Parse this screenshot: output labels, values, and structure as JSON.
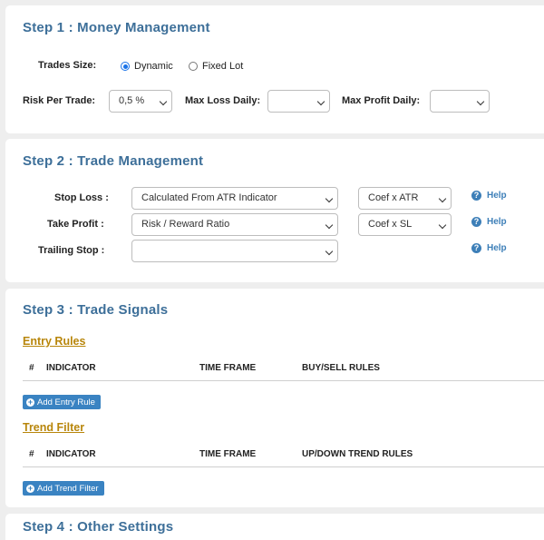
{
  "step1": {
    "title": "Step 1 : Money Management",
    "trades_size_label": "Trades Size:",
    "options": [
      "Dynamic",
      "Fixed Lot"
    ],
    "selected_option": "Dynamic",
    "risk_label": "Risk Per Trade:",
    "risk_value": "0,5 %",
    "max_loss_label": "Max Loss Daily:",
    "max_loss_value": "",
    "max_profit_label": "Max Profit Daily:",
    "max_profit_value": ""
  },
  "step2": {
    "title": "Step 2 : Trade Management",
    "help_label": "Help",
    "stop_loss": {
      "label": "Stop Loss :",
      "method": "Calculated From ATR Indicator",
      "coef": "Coef x ATR"
    },
    "take_profit": {
      "label": "Take Profit :",
      "method": "Risk / Reward Ratio",
      "coef": "Coef x SL"
    },
    "trailing_stop": {
      "label": "Trailing Stop :",
      "method": ""
    }
  },
  "step3": {
    "title": "Step 3 : Trade Signals",
    "entry": {
      "heading": "Entry Rules",
      "columns": [
        "#",
        "INDICATOR",
        "TIME FRAME",
        "BUY/SELL RULES"
      ],
      "button": "Add Entry Rule"
    },
    "trend": {
      "heading": "Trend Filter",
      "columns": [
        "#",
        "INDICATOR",
        "TIME FRAME",
        "UP/DOWN TREND RULES"
      ],
      "button": "Add Trend Filter"
    }
  },
  "step4": {
    "title": "Step 4 : Other Settings"
  }
}
